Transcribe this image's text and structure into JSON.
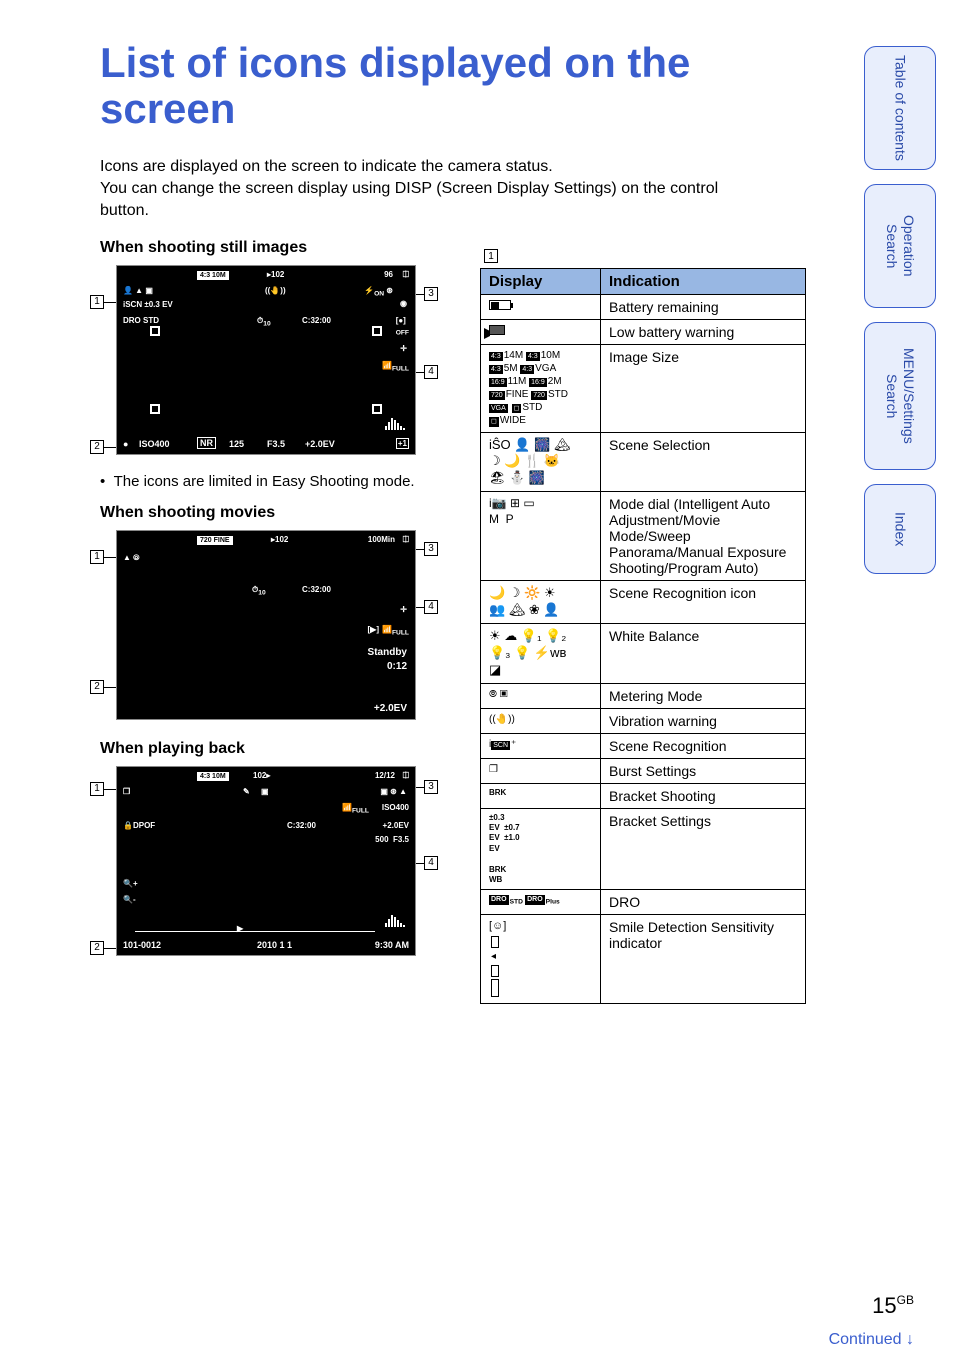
{
  "title": "List of icons displayed on the screen",
  "intro_line1": "Icons are displayed on the screen to indicate the camera status.",
  "intro_line2": "You can change the screen display using DISP (Screen Display Settings) on the control button.",
  "section1": "When shooting still images",
  "section2": "When shooting movies",
  "section3": "When playing back",
  "bullet1": "The icons are limited in Easy Shooting mode.",
  "table_header_display": "Display",
  "table_header_indication": "Indication",
  "rows": [
    {
      "disp": "batt",
      "ind": "Battery remaining"
    },
    {
      "disp": "lowbatt",
      "ind": "Low battery warning"
    },
    {
      "disp": "sizes",
      "disp_text": "4:3 14M  4:3 10M  4:3 5M  4:3 VGA  16:9 11M  16:9 2M  720 FINE  720 STD  VGA  STD  WIDE",
      "ind": "Image Size"
    },
    {
      "disp": "scene",
      "ind": "Scene Selection"
    },
    {
      "disp": "modedial",
      "disp_text": "iA  ◧  ▭  M  P",
      "ind": "Mode dial (Intelligent Auto Adjustment/Movie Mode/Sweep Panorama/Manual Exposure Shooting/Program Auto)"
    },
    {
      "disp": "scenerec",
      "ind": "Scene Recognition icon"
    },
    {
      "disp": "wb",
      "ind": "White Balance"
    },
    {
      "disp": "metering",
      "disp_text": "⦾  ▣",
      "ind": "Metering Mode"
    },
    {
      "disp": "vibration",
      "disp_text": "((🤚))",
      "ind": "Vibration warning"
    },
    {
      "disp": "iscn",
      "disp_text": "iSCN⁺",
      "ind": "Scene Recognition"
    },
    {
      "disp": "burst",
      "disp_text": "❐",
      "ind": "Burst Settings"
    },
    {
      "disp": "brk",
      "disp_text": "BRK",
      "ind": "Bracket Shooting"
    },
    {
      "disp": "brkset",
      "disp_text": "±0.3 EV  ±0.7 EV  ±1.0 EV  BRK WB",
      "ind": "Bracket Settings"
    },
    {
      "disp": "dro",
      "disp_text": "DRO STD  DRO Plus",
      "ind": "DRO"
    },
    {
      "disp": "smile",
      "ind": "Smile Detection Sensitivity indicator"
    }
  ],
  "tabs": {
    "toc": "Table of contents",
    "op": "Operation Search",
    "menu": "MENU/Settings Search",
    "index": "Index"
  },
  "page": "15",
  "page_suffix": "GB",
  "continued": "Continued",
  "screen1": {
    "topline": "4:3 10M",
    "folder": "102",
    "count": "96",
    "on": "ON",
    "drostd": "DRO STD",
    "ev": "±0.3 EV",
    "c3200": "C:32:00",
    "timer": "10",
    "off": "OFF",
    "full": "FULL",
    "bottom_dot": "●",
    "iso": "ISO400",
    "nr": "NR",
    "shutter": "125",
    "fnum": "F3.5",
    "evval": "+2.0EV",
    "plus1": "+1"
  },
  "screen2": {
    "fine": "720 FINE",
    "folder": "102",
    "min": "100Min",
    "timer": "10",
    "c3200": "C:32:00",
    "full": "FULL",
    "standby": "Standby",
    "time": "0:12",
    "evval": "+2.0EV"
  },
  "screen3": {
    "size": "4:3 10M",
    "folder": "102",
    "count": "12/12",
    "full": "FULL",
    "iso": "ISO400",
    "dpof": "DPOF",
    "c3200": "C:32:00",
    "evval": "+2.0EV",
    "shutter": "500",
    "fnum": "F3.5",
    "fileno": "101-0012",
    "date": "2010  1  1",
    "time": "9:30 AM"
  }
}
